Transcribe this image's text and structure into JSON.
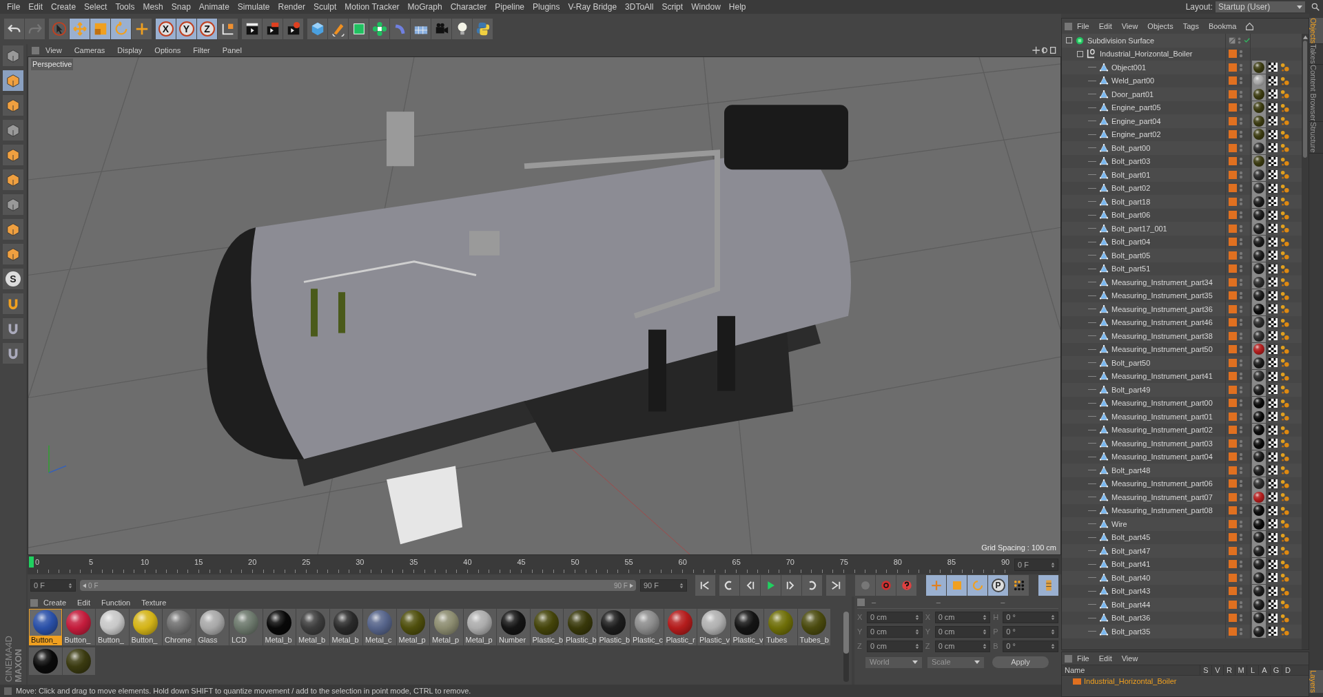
{
  "menu": [
    "File",
    "Edit",
    "Create",
    "Select",
    "Tools",
    "Mesh",
    "Snap",
    "Animate",
    "Simulate",
    "Render",
    "Sculpt",
    "Motion Tracker",
    "MoGraph",
    "Character",
    "Pipeline",
    "Plugins",
    "V-Ray Bridge",
    "3DToAll",
    "Script",
    "Window",
    "Help"
  ],
  "layout": {
    "label": "Layout:",
    "value": "Startup (User)"
  },
  "toolbar": {
    "axes": [
      "X",
      "Y",
      "Z"
    ]
  },
  "left_tools": {
    "snap_letter": "S"
  },
  "brand": [
    "MAXON",
    "CINEMA4D"
  ],
  "viewport": {
    "menu": [
      "View",
      "Cameras",
      "Display",
      "Options",
      "Filter",
      "Panel"
    ],
    "camera": "Perspective",
    "grid_spacing": "Grid Spacing : 100 cm"
  },
  "timeline": {
    "ticks": [
      "0",
      "5",
      "10",
      "15",
      "20",
      "25",
      "30",
      "35",
      "40",
      "45",
      "50",
      "55",
      "60",
      "65",
      "70",
      "75",
      "80",
      "85",
      "90"
    ],
    "current": "0 F",
    "start": "0 F",
    "range": {
      "start": "0 F",
      "end": "90 F",
      "level": 1
    },
    "end": "90 F"
  },
  "anim_toolbar": {
    "param_letter": "P"
  },
  "materials": {
    "menu": [
      "Create",
      "Edit",
      "Function",
      "Texture"
    ],
    "items": [
      {
        "name": "Button_",
        "color": "#2a50a8",
        "selected": true
      },
      {
        "name": "Button_",
        "color": "#c41c3c",
        "selected": false
      },
      {
        "name": "Button_",
        "color": "#c8c8c8",
        "selected": false
      },
      {
        "name": "Button_",
        "color": "#d4b418",
        "selected": false
      },
      {
        "name": "Chrome",
        "color": "#707070",
        "selected": false
      },
      {
        "name": "Glass",
        "color": "#a8a8a8",
        "selected": false
      },
      {
        "name": "LCD",
        "color": "#6c786c",
        "selected": false
      },
      {
        "name": "Metal_b",
        "color": "#080808",
        "selected": false
      },
      {
        "name": "Metal_b",
        "color": "#3c3c3c",
        "selected": false
      },
      {
        "name": "Metal_b",
        "color": "#2a2a2a",
        "selected": false
      },
      {
        "name": "Metal_c",
        "color": "#56648a",
        "selected": false
      },
      {
        "name": "Metal_p",
        "color": "#4e4e0c",
        "selected": false
      },
      {
        "name": "Metal_p",
        "color": "#8c8c70",
        "selected": false
      },
      {
        "name": "Metal_p",
        "color": "#acacac",
        "selected": false
      },
      {
        "name": "Number",
        "color": "#141414",
        "selected": false
      },
      {
        "name": "Plastic_b",
        "color": "#44440a",
        "selected": false
      },
      {
        "name": "Plastic_b",
        "color": "#38380a",
        "selected": false
      },
      {
        "name": "Plastic_b",
        "color": "#1c1c1c",
        "selected": false
      },
      {
        "name": "Plastic_c",
        "color": "#8c8c8c",
        "selected": false
      },
      {
        "name": "Plastic_r",
        "color": "#b41c1c",
        "selected": false
      },
      {
        "name": "Plastic_v",
        "color": "#b0b0b0",
        "selected": false
      },
      {
        "name": "Plastic_v",
        "color": "#141414",
        "selected": false
      },
      {
        "name": "Tubes",
        "color": "#6e6e08",
        "selected": false
      },
      {
        "name": "Tubes_b",
        "color": "#4a4a0e",
        "selected": false
      },
      {
        "color": "#0a0a0a",
        "selected": false
      },
      {
        "color": "#3a3a10",
        "selected": false
      }
    ]
  },
  "coordinates": {
    "headings": [
      "–",
      "–",
      "–"
    ],
    "position": [
      {
        "axis": "X",
        "value": "0 cm"
      },
      {
        "axis": "Y",
        "value": "0 cm"
      },
      {
        "axis": "Z",
        "value": "0 cm"
      }
    ],
    "size": [
      {
        "axis": "X",
        "value": "0 cm"
      },
      {
        "axis": "Y",
        "value": "0 cm"
      },
      {
        "axis": "Z",
        "value": "0 cm"
      }
    ],
    "rotation": [
      {
        "axis": "H",
        "value": "0 °"
      },
      {
        "axis": "P",
        "value": "0 °"
      },
      {
        "axis": "B",
        "value": "0 °"
      }
    ],
    "mode": "World",
    "transform": "Scale",
    "apply": "Apply"
  },
  "objects": {
    "menu": [
      "File",
      "Edit",
      "View",
      "Objects",
      "Tags",
      "Bookma"
    ],
    "tree": [
      {
        "name": "Subdivision Surface",
        "kind": "generator",
        "children": [
          {
            "name": "Industrial_Horizontal_Boiler",
            "kind": "null",
            "children": [
              {
                "name": "Object001",
                "kind": "polygon",
                "color": "#3a3a10"
              },
              {
                "name": "Weld_part00",
                "kind": "polygon",
                "color": "#a8a8a8"
              },
              {
                "name": "Door_part01",
                "kind": "polygon",
                "color": "#3a3a10"
              },
              {
                "name": "Engine_part05",
                "kind": "polygon",
                "color": "#3a3a10"
              },
              {
                "name": "Engine_part04",
                "kind": "polygon",
                "color": "#3a3a10"
              },
              {
                "name": "Engine_part02",
                "kind": "polygon",
                "color": "#3a3a10"
              },
              {
                "name": "Bolt_part00",
                "kind": "polygon",
                "color": "#2a2a2a"
              },
              {
                "name": "Bolt_part03",
                "kind": "polygon",
                "color": "#3a3a10"
              },
              {
                "name": "Bolt_part01",
                "kind": "polygon",
                "color": "#2a2a2a"
              },
              {
                "name": "Bolt_part02",
                "kind": "polygon",
                "color": "#2a2a2a"
              },
              {
                "name": "Bolt_part18",
                "kind": "polygon",
                "color": "#1a1a1a"
              },
              {
                "name": "Bolt_part06",
                "kind": "polygon",
                "color": "#1a1a1a"
              },
              {
                "name": "Bolt_part17_001",
                "kind": "polygon",
                "color": "#1a1a1a"
              },
              {
                "name": "Bolt_part04",
                "kind": "polygon",
                "color": "#1a1a1a"
              },
              {
                "name": "Bolt_part05",
                "kind": "polygon",
                "color": "#1a1a1a"
              },
              {
                "name": "Bolt_part51",
                "kind": "polygon",
                "color": "#1a1a1a"
              },
              {
                "name": "Measuring_Instrument_part34",
                "kind": "polygon",
                "color": "#2a2a2a"
              },
              {
                "name": "Measuring_Instrument_part35",
                "kind": "polygon",
                "color": "#1a1a1a"
              },
              {
                "name": "Measuring_Instrument_part36",
                "kind": "polygon",
                "color": "#0a0a0a"
              },
              {
                "name": "Measuring_Instrument_part46",
                "kind": "polygon",
                "color": "#2a2a2a"
              },
              {
                "name": "Measuring_Instrument_part38",
                "kind": "polygon",
                "color": "#2a2a2a"
              },
              {
                "name": "Measuring_Instrument_part50",
                "kind": "polygon",
                "color": "#b01c1c"
              },
              {
                "name": "Bolt_part50",
                "kind": "polygon",
                "color": "#1a1a1a"
              },
              {
                "name": "Measuring_Instrument_part41",
                "kind": "polygon",
                "color": "#2a2a2a"
              },
              {
                "name": "Bolt_part49",
                "kind": "polygon",
                "color": "#1a1a1a"
              },
              {
                "name": "Measuring_Instrument_part00",
                "kind": "polygon",
                "color": "#0a0a0a"
              },
              {
                "name": "Measuring_Instrument_part01",
                "kind": "polygon",
                "color": "#0a0a0a"
              },
              {
                "name": "Measuring_Instrument_part02",
                "kind": "polygon",
                "color": "#0a0a0a"
              },
              {
                "name": "Measuring_Instrument_part03",
                "kind": "polygon",
                "color": "#0a0a0a"
              },
              {
                "name": "Measuring_Instrument_part04",
                "kind": "polygon",
                "color": "#1a1a1a"
              },
              {
                "name": "Bolt_part48",
                "kind": "polygon",
                "color": "#1a1a1a"
              },
              {
                "name": "Measuring_Instrument_part06",
                "kind": "polygon",
                "color": "#2a2a2a"
              },
              {
                "name": "Measuring_Instrument_part07",
                "kind": "polygon",
                "color": "#b01c1c"
              },
              {
                "name": "Measuring_Instrument_part08",
                "kind": "polygon",
                "color": "#0a0a0a"
              },
              {
                "name": "Wire",
                "kind": "polygon",
                "color": "#0a0a0a"
              },
              {
                "name": "Bolt_part45",
                "kind": "polygon",
                "color": "#1a1a1a"
              },
              {
                "name": "Bolt_part47",
                "kind": "polygon",
                "color": "#1a1a1a"
              },
              {
                "name": "Bolt_part41",
                "kind": "polygon",
                "color": "#1a1a1a"
              },
              {
                "name": "Bolt_part40",
                "kind": "polygon",
                "color": "#1a1a1a"
              },
              {
                "name": "Bolt_part43",
                "kind": "polygon",
                "color": "#1a1a1a"
              },
              {
                "name": "Bolt_part44",
                "kind": "polygon",
                "color": "#1a1a1a"
              },
              {
                "name": "Bolt_part36",
                "kind": "polygon",
                "color": "#1a1a1a"
              },
              {
                "name": "Bolt_part35",
                "kind": "polygon",
                "color": "#1a1a1a"
              }
            ]
          }
        ]
      }
    ]
  },
  "side_tabs": [
    {
      "label": "Objects",
      "selected": true
    },
    {
      "label": "Takes",
      "selected": false
    },
    {
      "label": "Content Browser",
      "selected": false
    },
    {
      "label": "Structure",
      "selected": false
    }
  ],
  "layers": {
    "menu": [
      "File",
      "Edit",
      "View"
    ],
    "columns": [
      "Name",
      "S",
      "V",
      "R",
      "M",
      "L",
      "A",
      "G",
      "D"
    ],
    "rows": [
      {
        "name": "Industrial_Horizontal_Boiler",
        "color": "#e07020"
      }
    ],
    "tab": "Layers"
  },
  "status": "Move: Click and drag to move elements. Hold down SHIFT to quantize movement / add to the selection in point mode, CTRL to remove."
}
